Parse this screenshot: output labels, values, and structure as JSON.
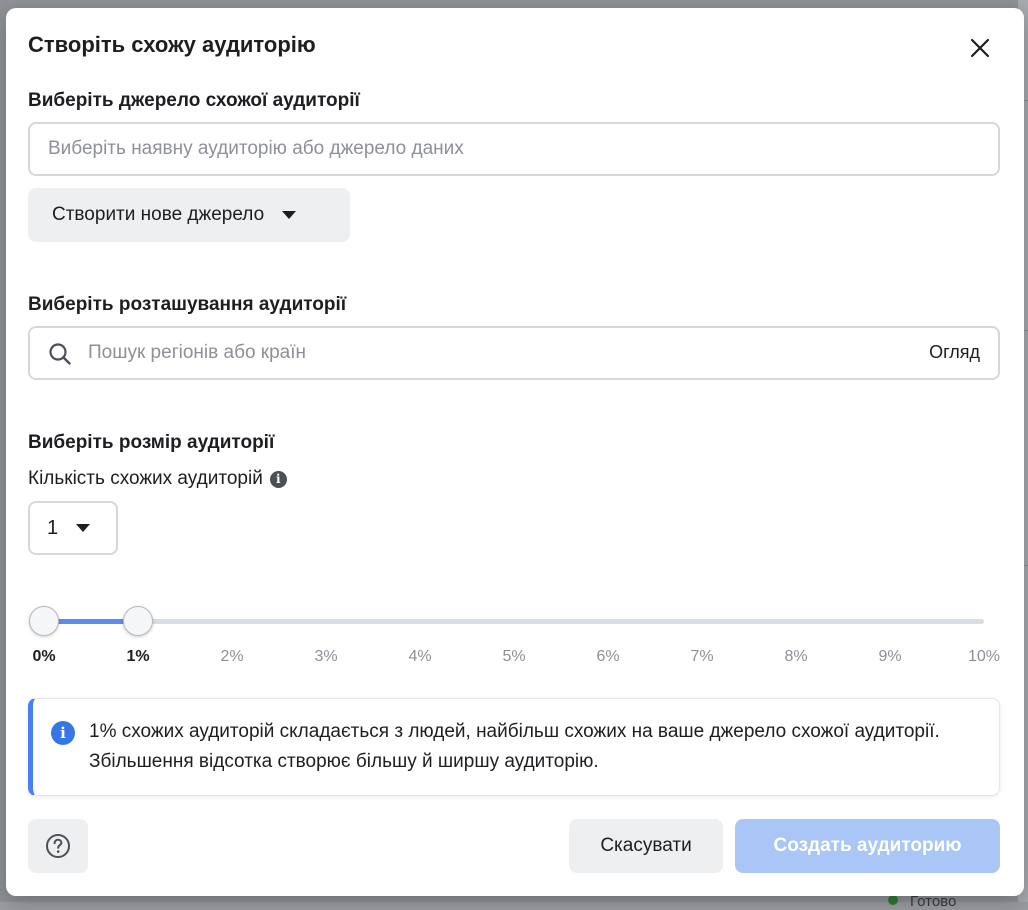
{
  "modal": {
    "title": "Створіть схожу аудиторію"
  },
  "source": {
    "label": "Виберіть джерело схожої аудиторії",
    "placeholder": "Виберіть наявну аудиторію або джерело даних",
    "create_new_label": "Створити нове джерело"
  },
  "location": {
    "label": "Виберіть розташування аудиторії",
    "placeholder": "Пошук регіонів або країн",
    "browse_label": "Огляд"
  },
  "size": {
    "label": "Виберіть розмір аудиторії",
    "count_label": "Кількість схожих аудиторій",
    "count_value": "1",
    "slider": {
      "min_percent": 0,
      "max_percent": 10,
      "start_percent": 0,
      "end_percent": 1,
      "ticks": [
        "0%",
        "1%",
        "2%",
        "3%",
        "4%",
        "5%",
        "6%",
        "7%",
        "8%",
        "9%",
        "10%"
      ]
    }
  },
  "info": {
    "text": "1% схожих аудиторій складається з людей, найбільш схожих на ваше джерело схожої аудиторії. Збільшення відсотка створює більшу й ширшу аудиторію."
  },
  "footer": {
    "cancel_label": "Скасувати",
    "create_label": "Создать аудиторию"
  },
  "background": {
    "status_text": "Готово"
  },
  "colors": {
    "accent": "#5b8def",
    "info_blue": "#3578e5",
    "disabled_primary": "#a9c6f6"
  }
}
